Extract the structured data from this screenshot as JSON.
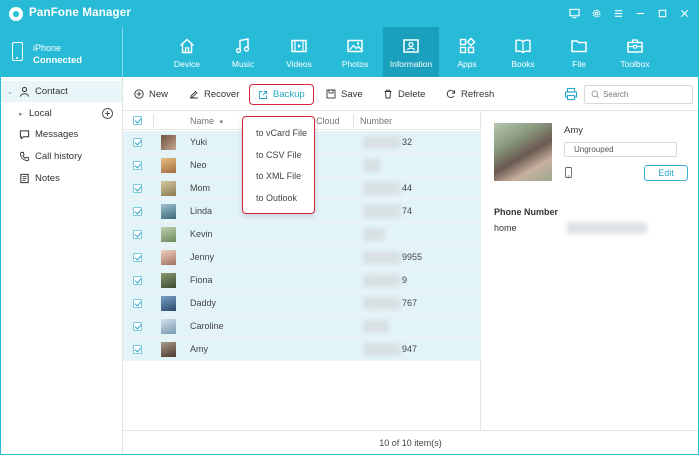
{
  "app": {
    "title": "PanFone Manager"
  },
  "device": {
    "name": "iPhone",
    "status": "Connected"
  },
  "nav": [
    {
      "id": "device",
      "label": "Device",
      "icon": "home-icon"
    },
    {
      "id": "music",
      "label": "Music",
      "icon": "music-icon"
    },
    {
      "id": "videos",
      "label": "Videos",
      "icon": "film-icon"
    },
    {
      "id": "photos",
      "label": "Photos",
      "icon": "image-icon"
    },
    {
      "id": "information",
      "label": "Information",
      "icon": "contact-card-icon",
      "active": true
    },
    {
      "id": "apps",
      "label": "Apps",
      "icon": "apps-grid-icon"
    },
    {
      "id": "books",
      "label": "Books",
      "icon": "book-icon"
    },
    {
      "id": "file",
      "label": "File",
      "icon": "folder-icon"
    },
    {
      "id": "toolbox",
      "label": "Toolbox",
      "icon": "toolbox-icon"
    }
  ],
  "sidebar": {
    "contact": "Contact",
    "local": "Local",
    "messages": "Messages",
    "call_history": "Call history",
    "notes": "Notes"
  },
  "toolbar": {
    "new": "New",
    "recover": "Recover",
    "backup": "Backup",
    "save": "Save",
    "delete": "Delete",
    "refresh": "Refresh",
    "search_placeholder": "Search"
  },
  "table": {
    "col_name": "Name",
    "col_cloud": "Cloud",
    "col_number": "Number",
    "rows": [
      {
        "name": "Yuki",
        "number_suffix": "32",
        "avatar": "#8a6a4a"
      },
      {
        "name": "Neo",
        "number_suffix": "",
        "avatar": "#c9a06a"
      },
      {
        "name": "Mom",
        "number_suffix": "44",
        "avatar": "#b8a070"
      },
      {
        "name": "Linda",
        "number_suffix": "74",
        "avatar": "#5a8a9a"
      },
      {
        "name": "Kevin",
        "number_suffix": "",
        "avatar": "#8aa078"
      },
      {
        "name": "Jenny",
        "number_suffix": "9955",
        "avatar": "#c89a8a"
      },
      {
        "name": "Fiona",
        "number_suffix": "9",
        "avatar": "#6a7a5a"
      },
      {
        "name": "Daddy",
        "number_suffix": "767",
        "avatar": "#4a6a8a"
      },
      {
        "name": "Caroline",
        "number_suffix": "",
        "avatar": "#9ab0c0"
      },
      {
        "name": "Amy",
        "number_suffix": "947",
        "avatar": "#7a6a5a"
      }
    ]
  },
  "backup_menu": [
    "to vCard File",
    "to CSV File",
    "to XML File",
    "to Outlook"
  ],
  "footer": {
    "count": "10 of 10 item(s)"
  },
  "detail": {
    "name": "Amy",
    "group": "Ungrouped",
    "edit": "Edit",
    "phone_section": "Phone Number",
    "phone_label": "home"
  },
  "colors": {
    "accent": "#27bbd8",
    "active_nav": "#1a9fbd",
    "highlight": "#d8243a",
    "row_selected": "#e3f4f9"
  }
}
